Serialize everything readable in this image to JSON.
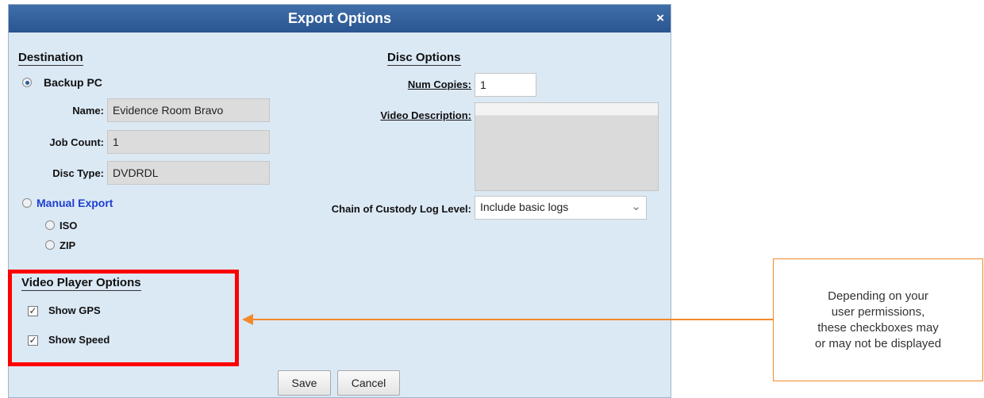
{
  "dialog": {
    "title": "Export Options",
    "close_glyph": "×"
  },
  "destination": {
    "section_title": "Destination",
    "backup_pc_label": "Backup PC",
    "backup_pc_selected": true,
    "name_label": "Name:",
    "name_value": "Evidence Room Bravo",
    "job_count_label": "Job Count:",
    "job_count_value": "1",
    "disc_type_label": "Disc Type:",
    "disc_type_value": "DVDRDL",
    "manual_export_label": "Manual Export",
    "iso_label": "ISO",
    "zip_label": "ZIP"
  },
  "disc_options": {
    "section_title": "Disc Options",
    "num_copies_label": "Num Copies:",
    "num_copies_value": "1",
    "video_description_label": "Video Description:",
    "video_description_value": "",
    "chain_label": "Chain of Custody Log Level:",
    "chain_value": "Include basic logs"
  },
  "video_player_options": {
    "section_title": "Video Player Options",
    "show_gps_label": "Show GPS",
    "show_gps_checked": true,
    "show_speed_label": "Show Speed",
    "show_speed_checked": true
  },
  "buttons": {
    "save_label": "Save",
    "cancel_label": "Cancel"
  },
  "annotation": {
    "line1": "Depending on your",
    "line2": "user permissions,",
    "line3": "these checkboxes may",
    "line4": "or may not be displayed",
    "highlight_color": "#ff0000",
    "arrow_color": "#f28a2a"
  },
  "icons": {
    "close": "close-icon",
    "dropdown": "chevron-down-icon",
    "check": "check-icon"
  }
}
